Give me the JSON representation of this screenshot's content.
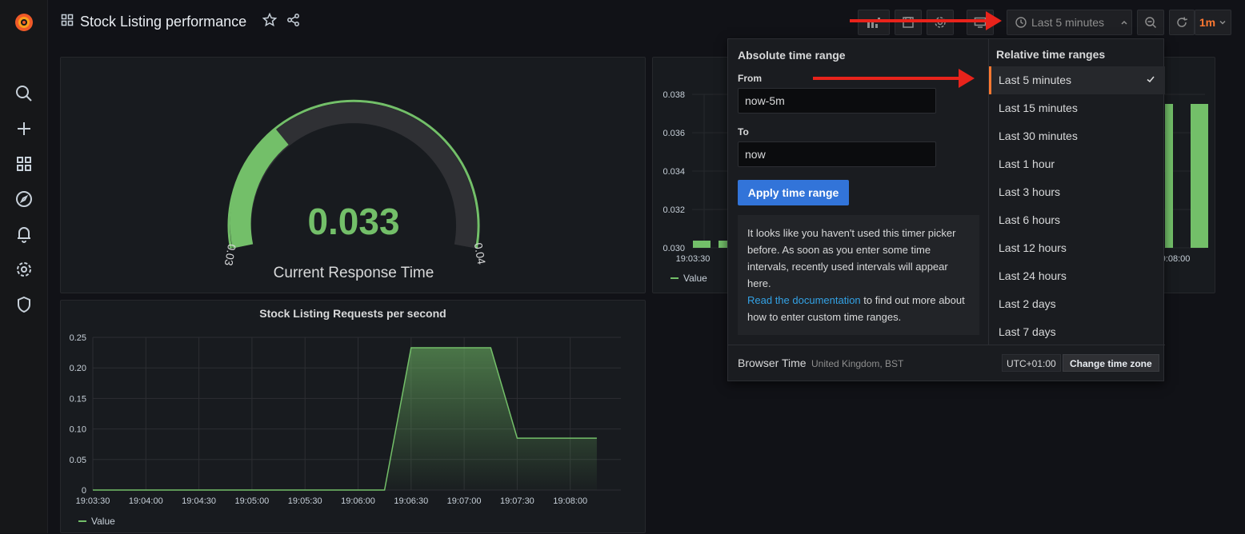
{
  "dashboard": {
    "title": "Stock Listing performance"
  },
  "toolbar": {
    "time_range_label": "Last 5 minutes",
    "refresh_interval": "1m"
  },
  "gauge_panel": {
    "value": "0.033",
    "name": "Current Response Time",
    "min": "0.03",
    "max": "0.04"
  },
  "bar_panel": {
    "y_ticks": [
      "0.038",
      "0.036",
      "0.034",
      "0.032",
      "0.030"
    ],
    "x_ticks": [
      "19:03:30",
      "19:08:00"
    ],
    "legend": "Value"
  },
  "line_panel": {
    "title": "Stock Listing Requests per second",
    "y_ticks": [
      "0.25",
      "0.20",
      "0.15",
      "0.10",
      "0.05",
      "0"
    ],
    "x_ticks": [
      "19:03:30",
      "19:04:00",
      "19:04:30",
      "19:05:00",
      "19:05:30",
      "19:06:00",
      "19:06:30",
      "19:07:00",
      "19:07:30",
      "19:08:00"
    ],
    "legend": "Value"
  },
  "chart_data": [
    {
      "type": "area",
      "title": "Stock Listing Requests per second",
      "x": [
        "19:03:30",
        "19:04:00",
        "19:04:30",
        "19:05:00",
        "19:05:30",
        "19:06:00",
        "19:06:15",
        "19:06:30",
        "19:07:00",
        "19:07:15",
        "19:07:30",
        "19:08:00",
        "19:08:15"
      ],
      "series": [
        {
          "name": "Value",
          "values": [
            0,
            0,
            0,
            0,
            0,
            0,
            0,
            0.233,
            0.233,
            0.233,
            0.085,
            0.085,
            0.085
          ]
        }
      ],
      "ylim": [
        0,
        0.25
      ],
      "grid": true,
      "legend_placement": "bottom-left"
    }
  ],
  "time_picker": {
    "absolute_title": "Absolute time range",
    "from_label": "From",
    "from_value": "now-5m",
    "to_label": "To",
    "to_value": "now",
    "apply_label": "Apply time range",
    "info_text": "It looks like you haven't used this timer picker before. As soon as you enter some time intervals, recently used intervals will appear here.",
    "info_link": "Read the documentation",
    "info_link_suffix": " to find out more about how to enter custom time ranges.",
    "relative_title": "Relative time ranges",
    "ranges": [
      "Last 5 minutes",
      "Last 15 minutes",
      "Last 30 minutes",
      "Last 1 hour",
      "Last 3 hours",
      "Last 6 hours",
      "Last 12 hours",
      "Last 24 hours",
      "Last 2 days",
      "Last 7 days"
    ],
    "browser_time_label": "Browser Time",
    "browser_time_zone": "United Kingdom, BST",
    "utc_offset": "UTC+01:00",
    "change_tz_label": "Change time zone"
  },
  "colors": {
    "accent_orange": "#ff7831",
    "series_green": "#73bf69",
    "primary_blue": "#3274d9",
    "annotation_red": "#e8231b"
  }
}
